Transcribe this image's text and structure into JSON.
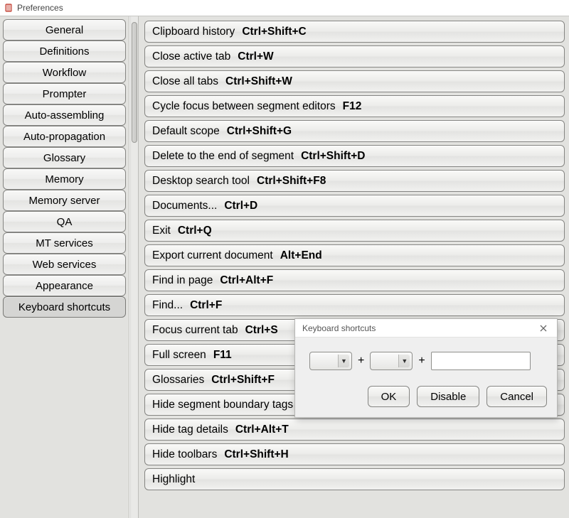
{
  "window": {
    "title": "Preferences"
  },
  "sidebar": {
    "items": [
      {
        "label": "General"
      },
      {
        "label": "Definitions"
      },
      {
        "label": "Workflow"
      },
      {
        "label": "Prompter"
      },
      {
        "label": "Auto-assembling"
      },
      {
        "label": "Auto-propagation"
      },
      {
        "label": "Glossary"
      },
      {
        "label": "Memory"
      },
      {
        "label": "Memory server"
      },
      {
        "label": "QA"
      },
      {
        "label": "MT services"
      },
      {
        "label": "Web services"
      },
      {
        "label": "Appearance"
      },
      {
        "label": "Keyboard shortcuts"
      }
    ],
    "selected_index": 13
  },
  "shortcuts": [
    {
      "label": "Clipboard history",
      "key": "Ctrl+Shift+C"
    },
    {
      "label": "Close active tab",
      "key": "Ctrl+W"
    },
    {
      "label": "Close all tabs",
      "key": "Ctrl+Shift+W"
    },
    {
      "label": "Cycle focus between segment editors",
      "key": "F12"
    },
    {
      "label": "Default scope",
      "key": "Ctrl+Shift+G"
    },
    {
      "label": "Delete to the end of segment",
      "key": "Ctrl+Shift+D"
    },
    {
      "label": "Desktop search tool",
      "key": "Ctrl+Shift+F8"
    },
    {
      "label": "Documents...",
      "key": "Ctrl+D"
    },
    {
      "label": "Exit",
      "key": "Ctrl+Q"
    },
    {
      "label": "Export current document",
      "key": "Alt+End"
    },
    {
      "label": "Find in page",
      "key": "Ctrl+Alt+F"
    },
    {
      "label": "Find...",
      "key": "Ctrl+F"
    },
    {
      "label": "Focus current tab",
      "key": "Ctrl+S"
    },
    {
      "label": "Full screen",
      "key": "F11"
    },
    {
      "label": "Glossaries",
      "key": "Ctrl+Shift+F"
    },
    {
      "label": "Hide segment boundary tags",
      "key": ""
    },
    {
      "label": "Hide tag details",
      "key": "Ctrl+Alt+T"
    },
    {
      "label": "Hide toolbars",
      "key": "Ctrl+Shift+H"
    },
    {
      "label": "Highlight",
      "key": ""
    }
  ],
  "dialog": {
    "title": "Keyboard shortcuts",
    "plus": "+",
    "buttons": {
      "ok": "OK",
      "disable": "Disable",
      "cancel": "Cancel"
    }
  }
}
